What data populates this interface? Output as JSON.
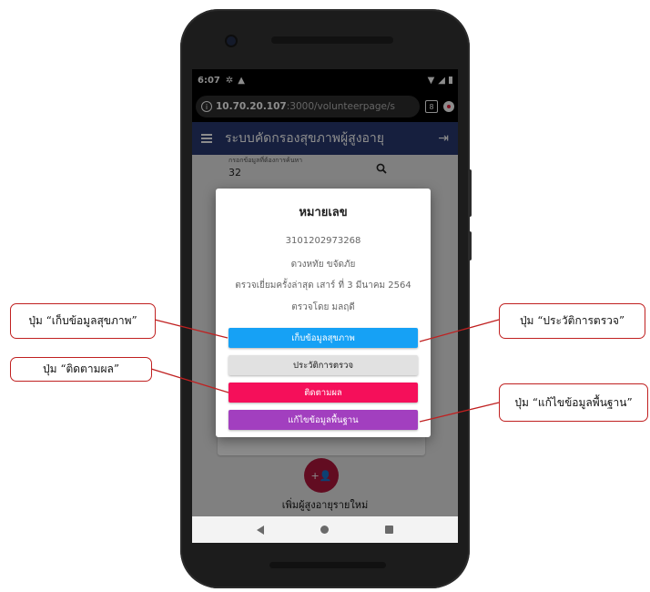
{
  "status_bar": {
    "time": "6:07"
  },
  "browser": {
    "url_host": "10.70.20.107",
    "url_path": ":3000/volunteerpage/s",
    "tab_count": "8"
  },
  "app_bar": {
    "title": "ระบบคัดกรองสุขภาพผู้สูงอายุ"
  },
  "search": {
    "label": "กรอกข้อมูลที่ต้องการค้นหา",
    "value": "32"
  },
  "dialog": {
    "title": "หมายเลข",
    "id_number": "3101202973268",
    "name": "ดวงหทัย ขจัดภัย",
    "last_visit": "ตรวจเยี่ยมครั้งล่าสุด เสาร์ ที่ 3 มีนาคม 2564",
    "checked_by": "ตรวจโดย มลฤดี",
    "buttons": {
      "collect_health": "เก็บข้อมูลสุขภาพ",
      "history": "ประวัติการตรวจ",
      "follow_up": "ติดตามผล",
      "edit_base": "แก้ไขข้อมูลพื้นฐาน"
    }
  },
  "add_elder": {
    "label": "เพิ่มผู้สูงอายุรายใหม่"
  },
  "callouts": {
    "collect_health": "ปุ่ม “เก็บข้อมูลสุขภาพ”",
    "follow_up": "ปุ่ม “ติดตามผล”",
    "history": "ปุ่ม “ประวัติการตรวจ”",
    "edit_base": "ปุ่ม “แก้ไขข้อมูลพื้นฐาน”"
  },
  "colors": {
    "app_bar": "#283a72",
    "btn_collect": "#16a1f5",
    "btn_history": "#e1e1e1",
    "btn_follow": "#f50f5a",
    "btn_edit": "#a23fbf",
    "fab": "#b2173d",
    "callout_border": "#c02020"
  }
}
